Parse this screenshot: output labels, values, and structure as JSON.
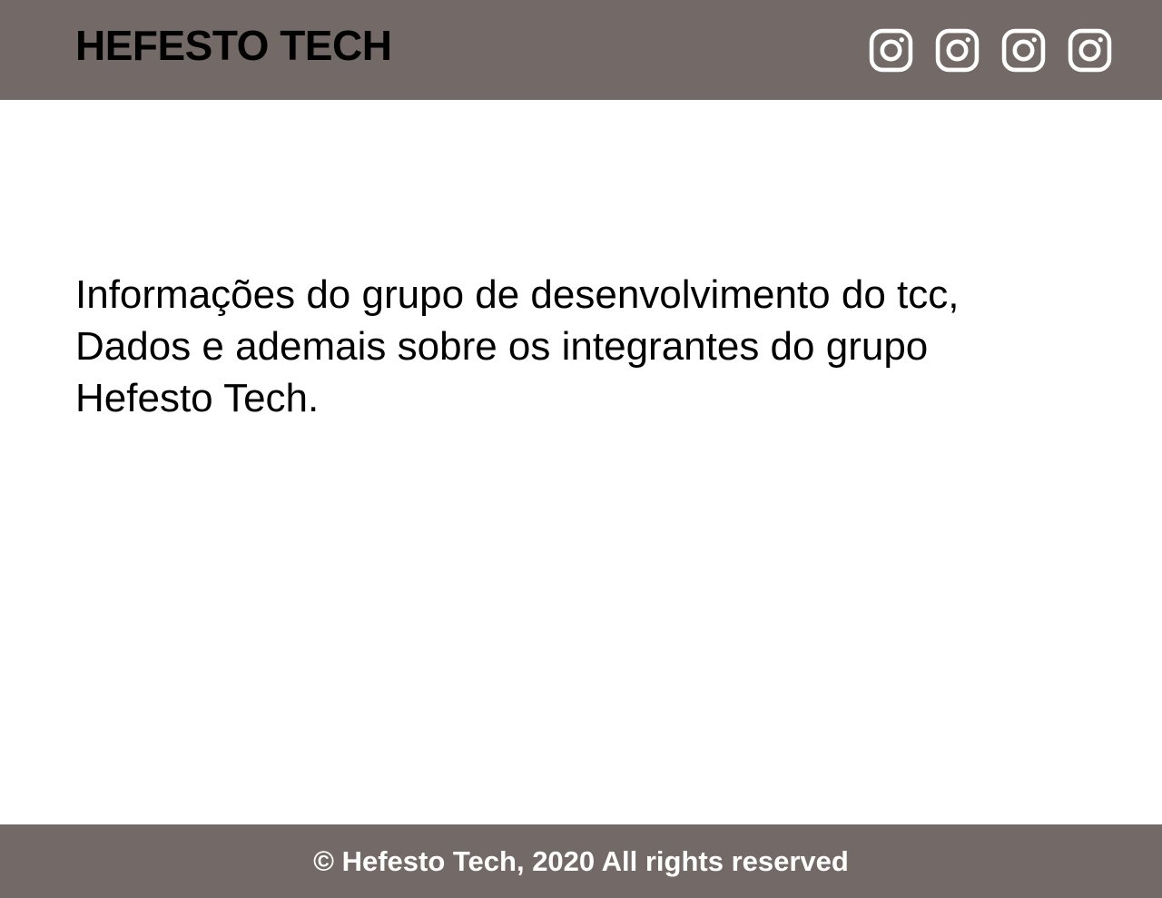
{
  "header": {
    "brand": "HEFESTO TECH",
    "social_links": [
      {
        "icon": "instagram-icon"
      },
      {
        "icon": "instagram-icon"
      },
      {
        "icon": "instagram-icon"
      },
      {
        "icon": "instagram-icon"
      }
    ]
  },
  "main": {
    "intro_lines": [
      "Informações do grupo de desenvolvimento do tcc,",
      "Dados e ademais sobre os integrantes do grupo",
      "Hefesto Tech."
    ]
  },
  "footer": {
    "copyright": "© Hefesto Tech, 2020 All rights reserved"
  },
  "colors": {
    "header_bg": "#736a68",
    "footer_bg": "#736a68",
    "page_bg": "#ffffff",
    "icon": "#ffffff"
  }
}
